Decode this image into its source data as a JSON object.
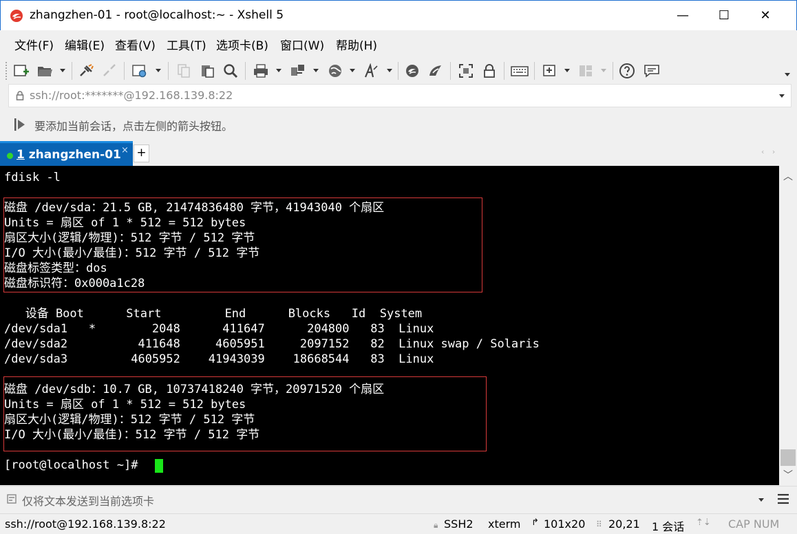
{
  "window": {
    "title": "zhangzhen-01 - root@localhost:~ - Xshell 5",
    "minimize": "—",
    "maximize": "☐",
    "close": "✕"
  },
  "menu": [
    "文件(F)",
    "编辑(E)",
    "查看(V)",
    "工具(T)",
    "选项卡(B)",
    "窗口(W)",
    "帮助(H)"
  ],
  "address": {
    "url": "ssh://root:*******@192.168.139.8:22"
  },
  "hint": {
    "text": "要添加当前会话，点击左侧的箭头按钮。"
  },
  "tab": {
    "number": "1",
    "name": "zhangzhen-01",
    "close": "×",
    "add": "+",
    "nav": "‹ ›"
  },
  "terminal": {
    "lines": [
      "fdisk -l",
      "",
      "磁盘 /dev/sda：21.5 GB, 21474836480 字节，41943040 个扇区",
      "Units = 扇区 of 1 * 512 = 512 bytes",
      "扇区大小(逻辑/物理)：512 字节 / 512 字节",
      "I/O 大小(最小/最佳)：512 字节 / 512 字节",
      "磁盘标签类型：dos",
      "磁盘标识符：0x000a1c28",
      "",
      "   设备 Boot      Start         End      Blocks   Id  System",
      "/dev/sda1   *        2048      411647      204800   83  Linux",
      "/dev/sda2          411648     4605951     2097152   82  Linux swap / Solaris",
      "/dev/sda3         4605952    41943039    18668544   83  Linux",
      "",
      "磁盘 /dev/sdb：10.7 GB, 10737418240 字节，20971520 个扇区",
      "Units = 扇区 of 1 * 512 = 512 bytes",
      "扇区大小(逻辑/物理)：512 字节 / 512 字节",
      "I/O 大小(最小/最佳)：512 字节 / 512 字节",
      "",
      "[root@localhost ~]# "
    ]
  },
  "sendbar": {
    "placeholder": "仅将文本发送到当前选项卡"
  },
  "status": {
    "connection": "ssh://root@192.168.139.8:22",
    "protocol": "SSH2",
    "terminal_type": "xterm",
    "size": "101x20",
    "cursor_pos": "20,21",
    "sessions": "1 会话",
    "caps": "CAP NUM"
  },
  "colors": {
    "tab_active": "#0a64b4",
    "terminal_bg": "#000000",
    "terminal_fg": "#ffffff",
    "cursor": "#19e619",
    "highlight_box": "#d83a3a"
  }
}
